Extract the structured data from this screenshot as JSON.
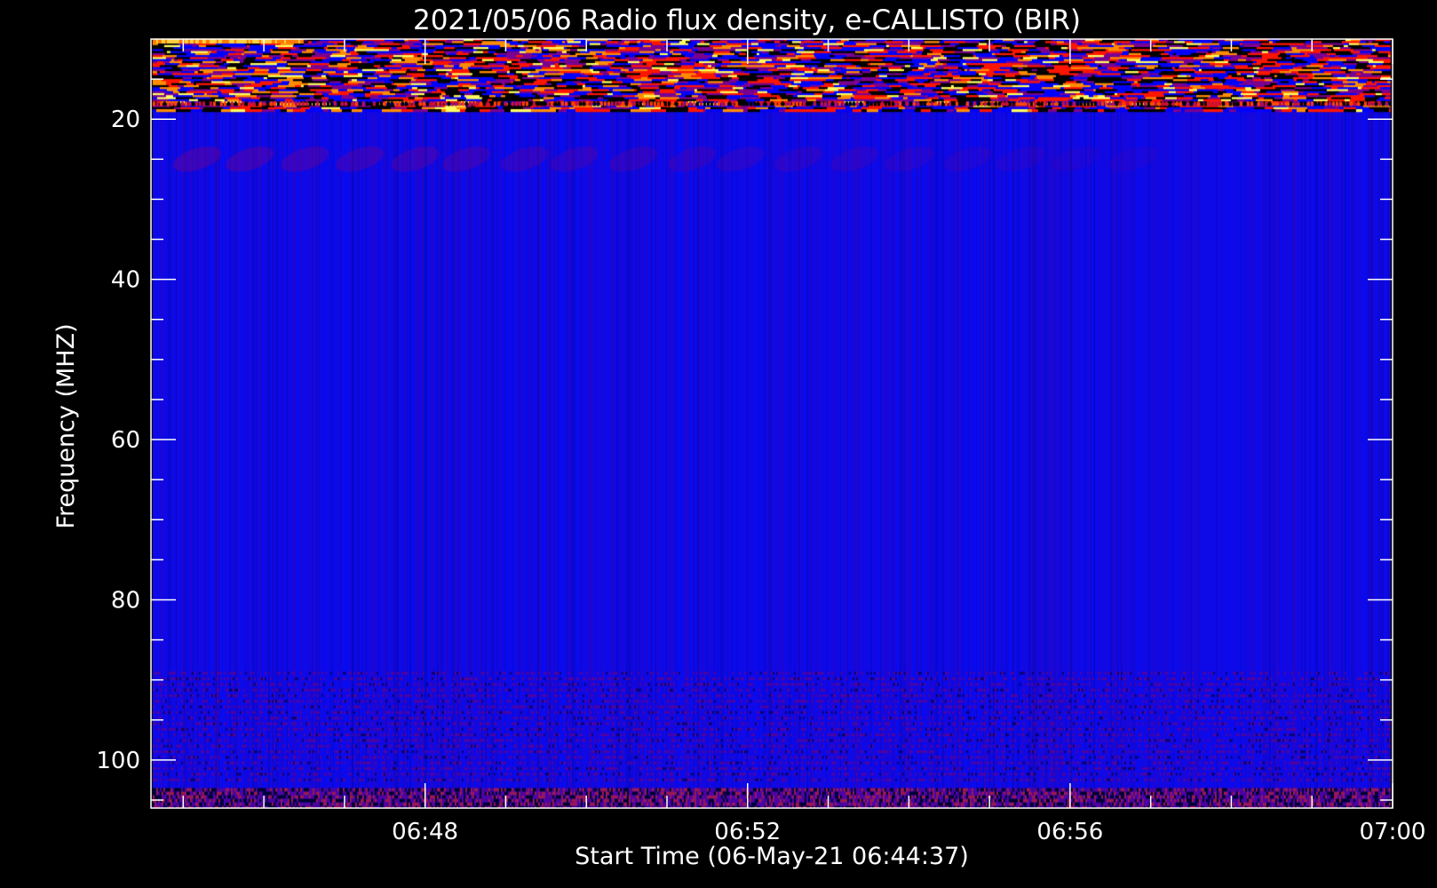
{
  "chart_data": {
    "type": "heatmap",
    "title": "2021/05/06  Radio flux density, e-CALLISTO (BIR)",
    "xlabel": "Start Time (06-May-21 06:44:37)",
    "ylabel": "Frequency (MHZ)",
    "x_ticks": [
      "06:48",
      "06:52",
      "06:56",
      "07:00"
    ],
    "y_ticks": [
      "20",
      "40",
      "60",
      "80",
      "100"
    ],
    "x_range_minutes": [
      44.6,
      60.0
    ],
    "y_range_mhz": [
      10,
      106
    ],
    "y_axis_inverted": true,
    "data_time_range_minutes": [
      44.62,
      59.98
    ],
    "colormap": [
      "#000000",
      "#0000ff",
      "#7a0090",
      "#ff1500",
      "#ff8c00",
      "#ffff60"
    ],
    "background_color": "#0a0aef",
    "features": [
      {
        "name": "top interference band",
        "freq_range_mhz": [
          10,
          19
        ],
        "intensity": "high"
      },
      {
        "name": "faint drifting features",
        "freq_range_mhz": [
          23,
          27
        ],
        "intensity": "low"
      },
      {
        "name": "lower interference bands",
        "freq_range_mhz": [
          89,
          103
        ],
        "intensity": "medium-low"
      },
      {
        "name": "bottom strong band",
        "freq_range_mhz": [
          103,
          106
        ],
        "intensity": "medium"
      }
    ]
  }
}
